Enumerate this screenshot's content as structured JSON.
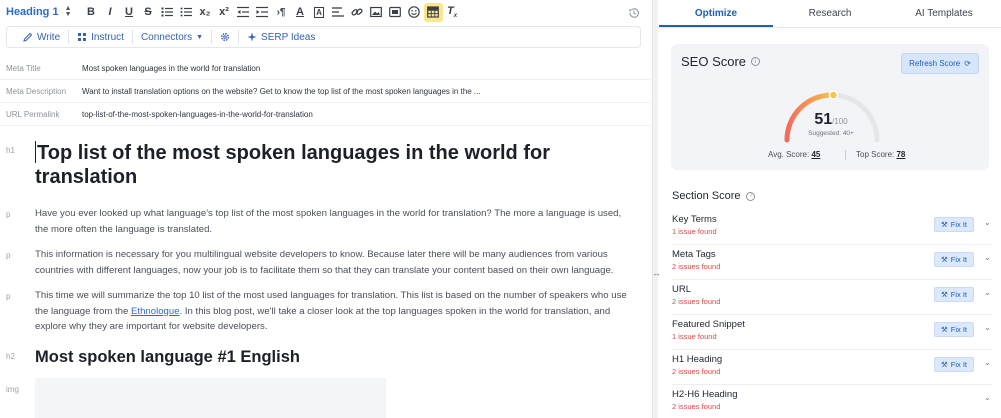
{
  "toolbar": {
    "heading_select": "Heading 1",
    "icons": [
      "bold-icon",
      "italic-icon",
      "underline-icon",
      "strikethrough-icon",
      "ordered-list-icon",
      "bullet-list-icon",
      "subscript-icon",
      "superscript-icon",
      "outdent-icon",
      "indent-icon",
      "paragraph-direction-icon",
      "text-color-icon",
      "highlight-icon",
      "align-icon",
      "link-icon",
      "image-icon",
      "video-icon",
      "emoji-icon",
      "table-icon",
      "clear-format-icon"
    ],
    "b": "B",
    "i": "I",
    "u": "U",
    "s": "S",
    "sub": "x₂",
    "sup": "x²"
  },
  "subbar": {
    "write": "Write",
    "instruct": "Instruct",
    "connectors": "Connectors",
    "serp": "SERP Ideas"
  },
  "meta": {
    "title_label": "Meta Title",
    "title_value": "Most spoken languages in the world for translation",
    "desc_label": "Meta Description",
    "desc_value": "Want to install translation options on the website? Get to know the top list of the most spoken languages in the ...",
    "url_label": "URL Permalink",
    "url_value": "top-list-of-the-most-spoken-languages-in-the-world-for-translation"
  },
  "content": {
    "h1_tag": "h1",
    "h1": "Top list of the most spoken languages in the world for translation",
    "p_tag": "p",
    "p1": "Have you ever looked up what language's top list of the most spoken languages in the world for translation? The more a language is used, the more often the language is translated.",
    "p2": "This information is necessary for you multilingual website developers to know. Because later there will be many audiences from various countries with different languages, now your job is to facilitate them so that they can translate your content based on their own language.",
    "p3_before": "This time we will summarize the top 10 list of the most used languages for translation. This list is based on the number of speakers who use the language from the ",
    "p3_link": "Ethnologue",
    "p3_after": ". In this blog post, we'll take a closer look at the top languages spoken in the world for translation, and explore why they are important for website developers.",
    "h2_tag": "h2",
    "h2": "Most spoken language #1 English",
    "img_tag": "img"
  },
  "panel": {
    "tabs": [
      {
        "label": "Optimize",
        "active": true
      },
      {
        "label": "Research",
        "active": false
      },
      {
        "label": "AI Templates",
        "active": false
      }
    ],
    "seo_title": "SEO Score",
    "refresh": "Refresh Score",
    "score": "51",
    "score_max": "/100",
    "suggested": "Suggested: 40+",
    "avg_label": "Avg. Score:",
    "avg_value": "45",
    "top_label": "Top Score:",
    "top_value": "78",
    "section_title": "Section Score",
    "fix_label": "Fix It",
    "sections": [
      {
        "name": "Key Terms",
        "issues": "1 issue found",
        "fix": true
      },
      {
        "name": "Meta Tags",
        "issues": "2 issues found",
        "fix": true
      },
      {
        "name": "URL",
        "issues": "2 issues found",
        "fix": true
      },
      {
        "name": "Featured Snippet",
        "issues": "1 issue found",
        "fix": true
      },
      {
        "name": "H1 Heading",
        "issues": "2 issues found",
        "fix": true
      },
      {
        "name": "H2-H6 Heading",
        "issues": "2 issues found",
        "fix": false
      }
    ],
    "colors": {
      "accent": "#1f5fb8",
      "issue": "#e14848",
      "gauge_low": "#f26b5b",
      "gauge_high": "#f6c44f"
    }
  }
}
